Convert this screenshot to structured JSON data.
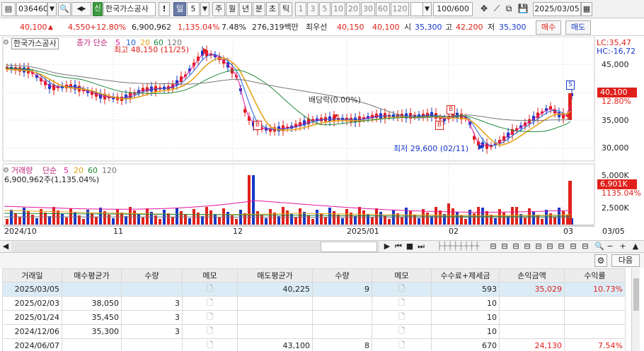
{
  "toolbar": {
    "code": "036460",
    "market_tag": "신",
    "stock_name": "한국가스공사",
    "period_selected": "일",
    "period_value": "5",
    "periods": [
      "주",
      "월",
      "년",
      "분",
      "초",
      "틱"
    ],
    "intervals": [
      "1",
      "3",
      "5",
      "10",
      "20",
      "30",
      "60",
      "120"
    ],
    "count": "100",
    "count_total": "/600",
    "date": "2025/03/05"
  },
  "info": {
    "price": "40,100",
    "change": "4,550",
    "change_pct": "+12.80%",
    "volume": "6,900,962",
    "volume_pct": "1,135.04%",
    "turnover": "7.48%",
    "amount": "276,319백만",
    "best_label": "최우선",
    "best_ask": "40,150",
    "best_bid": "40,100",
    "open_label": "시",
    "open": "35,300",
    "high_label": "고",
    "high": "42,200",
    "low_label": "저",
    "low": "35,300",
    "buy_button": "매수",
    "sell_button": "매도"
  },
  "chart": {
    "name_tag": "한국가스공사",
    "ma_title": "종가 단순",
    "ma_periods": [
      "5",
      "10",
      "20",
      "60",
      "120"
    ],
    "ma_colors": [
      "#e3199b",
      "#1f5fd6",
      "#e5a51a",
      "#1f8a3b",
      "#777777"
    ],
    "high_note": "최고 48,150 (11/25)",
    "low_note": "최저 29,600 (02/11)",
    "dividend_note": "배당락(0.00%)",
    "lc": "LC:35,47",
    "hc": "HC:-16,72",
    "price_ticks": [
      "45,000",
      "40,000",
      "35,000",
      "30,000"
    ],
    "current_price_tag": "40,100",
    "current_pct_tag": "12.80%",
    "volume_title": "거래량",
    "volume_ma_title": "단순",
    "volume_ma_periods": [
      "5",
      "20",
      "60",
      "120"
    ],
    "volume_note": "6,900,962주(1,135.04%)",
    "volume_ticks": [
      "5,000K",
      "2,500K"
    ],
    "volume_tag": "6,901K",
    "volume_pct_tag": "1135.04%",
    "date_ticks": [
      "2024/10",
      "11",
      "12",
      "2025/01",
      "02",
      "03"
    ],
    "date_end": "03/05",
    "marker_b": "B",
    "marker_s": "S",
    "up_color": "#e0201a",
    "down_color": "#1737c8"
  },
  "table": {
    "next_button": "다음",
    "headers": [
      "거래일",
      "매수평균가",
      "수량",
      "메모",
      "매도평균가",
      "수량",
      "메모",
      "수수료+제세금",
      "손익금액",
      "수익률"
    ],
    "rows": [
      {
        "date": "2025/03/05",
        "buy_avg": "",
        "buy_qty": "",
        "sell_avg": "40,225",
        "sell_qty": "9",
        "fee": "593",
        "pnl": "35,029",
        "ret": "10.73%"
      },
      {
        "date": "2025/02/03",
        "buy_avg": "38,050",
        "buy_qty": "3",
        "sell_avg": "",
        "sell_qty": "",
        "fee": "10",
        "pnl": "",
        "ret": ""
      },
      {
        "date": "2025/01/24",
        "buy_avg": "35,450",
        "buy_qty": "3",
        "sell_avg": "",
        "sell_qty": "",
        "fee": "10",
        "pnl": "",
        "ret": ""
      },
      {
        "date": "2024/12/06",
        "buy_avg": "35,300",
        "buy_qty": "3",
        "sell_avg": "",
        "sell_qty": "",
        "fee": "10",
        "pnl": "",
        "ret": ""
      },
      {
        "date": "2024/06/07",
        "buy_avg": "",
        "buy_qty": "",
        "sell_avg": "43,100",
        "sell_qty": "8",
        "fee": "670",
        "pnl": "24,130",
        "ret": "7.54%"
      }
    ]
  }
}
